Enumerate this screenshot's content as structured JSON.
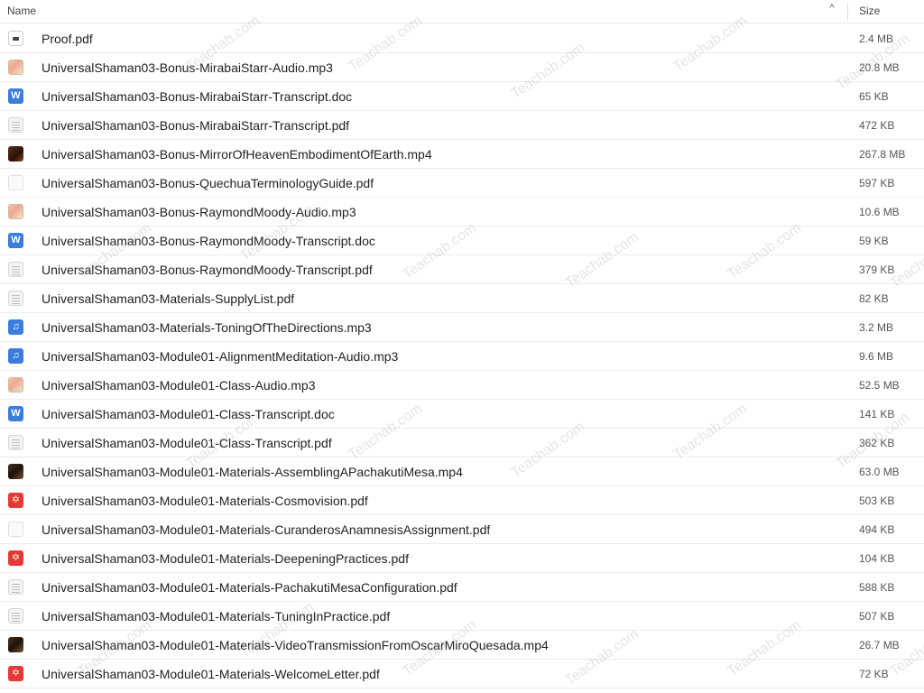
{
  "header": {
    "name_label": "Name",
    "sort_indicator": "^",
    "size_label": "Size"
  },
  "watermark_text": "Teachab.com",
  "files": [
    {
      "name": "Proof.pdf",
      "size": "2.4 MB",
      "icon": "proof-pdf-thumbnail-icon"
    },
    {
      "name": "UniversalShaman03-Bonus-MirabaiStarr-Audio.mp3",
      "size": "20.8 MB",
      "icon": "audio-thumbnail-icon"
    },
    {
      "name": "UniversalShaman03-Bonus-MirabaiStarr-Transcript.doc",
      "size": "65 KB",
      "icon": "word-doc-icon"
    },
    {
      "name": "UniversalShaman03-Bonus-MirabaiStarr-Transcript.pdf",
      "size": "472 KB",
      "icon": "pdf-thumbnail-icon"
    },
    {
      "name": "UniversalShaman03-Bonus-MirrorOfHeavenEmbodimentOfEarth.mp4",
      "size": "267.8 MB",
      "icon": "video-thumbnail-icon"
    },
    {
      "name": "UniversalShaman03-Bonus-QuechuaTerminologyGuide.pdf",
      "size": "597 KB",
      "icon": "pdf-small-thumbnail-icon"
    },
    {
      "name": "UniversalShaman03-Bonus-RaymondMoody-Audio.mp3",
      "size": "10.6 MB",
      "icon": "audio-thumbnail-icon"
    },
    {
      "name": "UniversalShaman03-Bonus-RaymondMoody-Transcript.doc",
      "size": "59 KB",
      "icon": "word-doc-icon"
    },
    {
      "name": "UniversalShaman03-Bonus-RaymondMoody-Transcript.pdf",
      "size": "379 KB",
      "icon": "pdf-thumbnail-icon"
    },
    {
      "name": "UniversalShaman03-Materials-SupplyList.pdf",
      "size": "82 KB",
      "icon": "pdf-thumbnail-icon"
    },
    {
      "name": "UniversalShaman03-Materials-ToningOfTheDirections.mp3",
      "size": "3.2 MB",
      "icon": "music-note-icon"
    },
    {
      "name": "UniversalShaman03-Module01-AlignmentMeditation-Audio.mp3",
      "size": "9.6 MB",
      "icon": "music-note-icon"
    },
    {
      "name": "UniversalShaman03-Module01-Class-Audio.mp3",
      "size": "52.5 MB",
      "icon": "audio-thumbnail-icon"
    },
    {
      "name": "UniversalShaman03-Module01-Class-Transcript.doc",
      "size": "141 KB",
      "icon": "word-doc-icon"
    },
    {
      "name": "UniversalShaman03-Module01-Class-Transcript.pdf",
      "size": "362 KB",
      "icon": "pdf-thumbnail-icon"
    },
    {
      "name": "UniversalShaman03-Module01-Materials-AssemblingAPachakutiMesa.mp4",
      "size": "63.0 MB",
      "icon": "video-thumbnail-icon"
    },
    {
      "name": "UniversalShaman03-Module01-Materials-Cosmovision.pdf",
      "size": "503 KB",
      "icon": "pdf-acrobat-icon"
    },
    {
      "name": "UniversalShaman03-Module01-Materials-CuranderosAnamnesisAssignment.pdf",
      "size": "494 KB",
      "icon": "pdf-small-thumbnail-icon"
    },
    {
      "name": "UniversalShaman03-Module01-Materials-DeepeningPractices.pdf",
      "size": "104 KB",
      "icon": "pdf-acrobat-icon"
    },
    {
      "name": "UniversalShaman03-Module01-Materials-PachakutiMesaConfiguration.pdf",
      "size": "588 KB",
      "icon": "pdf-thumbnail-icon"
    },
    {
      "name": "UniversalShaman03-Module01-Materials-TuningInPractice.pdf",
      "size": "507 KB",
      "icon": "pdf-thumbnail-icon"
    },
    {
      "name": "UniversalShaman03-Module01-Materials-VideoTransmissionFromOscarMiroQuesada.mp4",
      "size": "26.7 MB",
      "icon": "video-thumbnail-icon"
    },
    {
      "name": "UniversalShaman03-Module01-Materials-WelcomeLetter.pdf",
      "size": "72 KB",
      "icon": "pdf-acrobat-icon"
    }
  ]
}
